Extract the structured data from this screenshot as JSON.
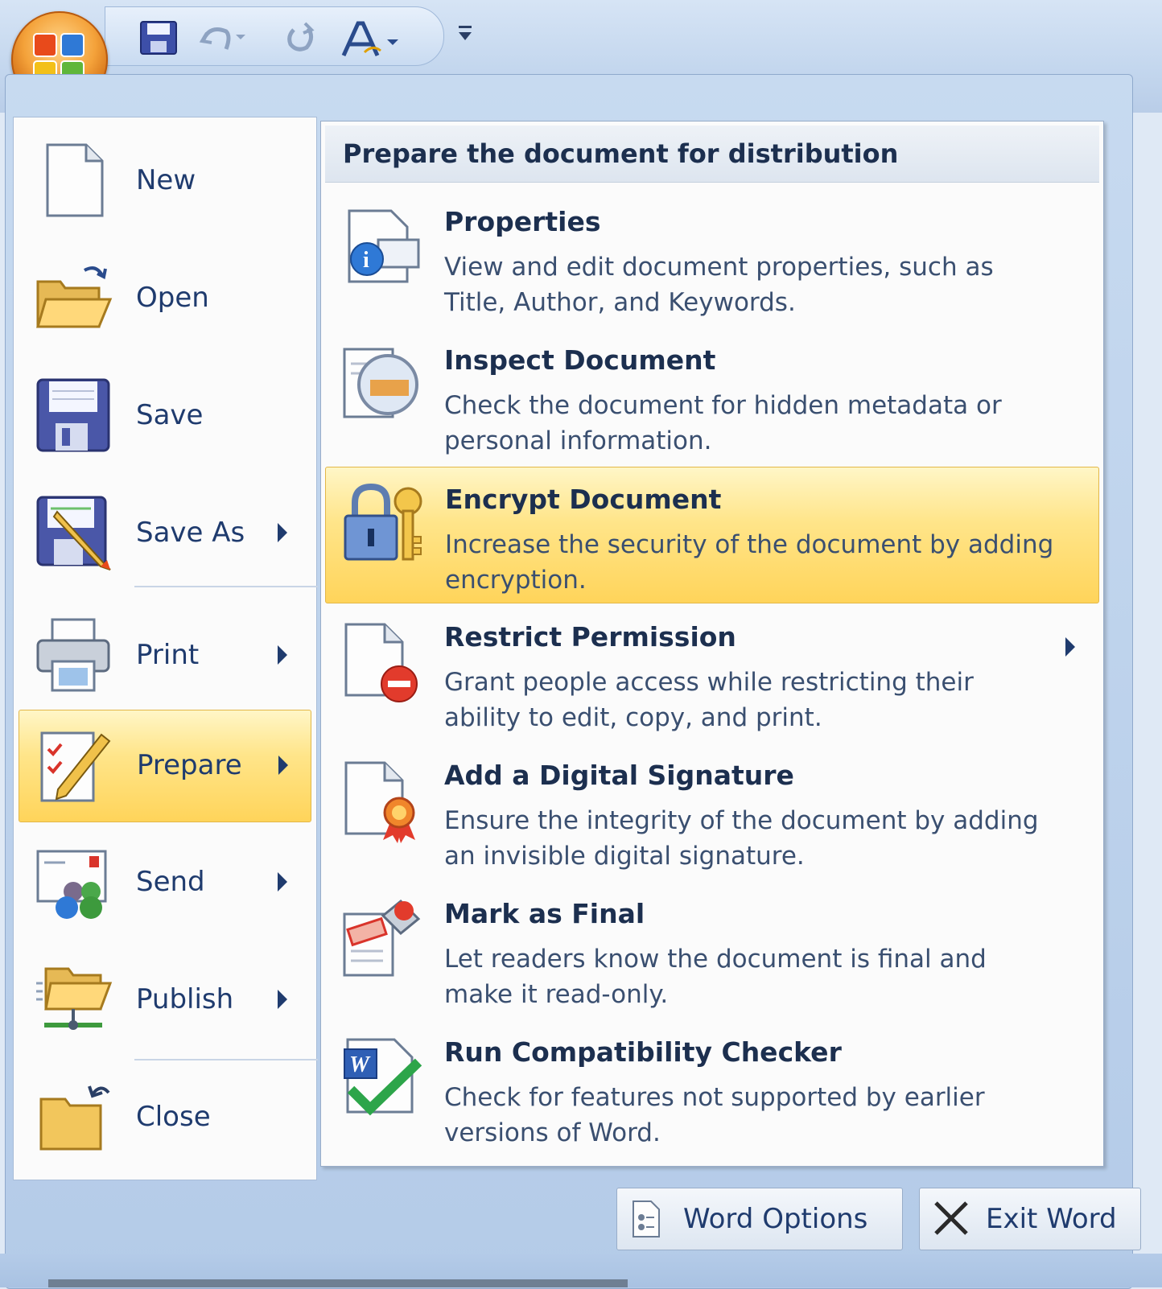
{
  "quick_access_toolbar": {
    "buttons": [
      {
        "icon": "save-icon"
      },
      {
        "icon": "undo-icon"
      },
      {
        "icon": "redo-icon"
      },
      {
        "icon": "font-style-icon"
      },
      {
        "icon": "customize-dropdown-icon"
      }
    ],
    "office_button_icon": "office-logo-icon"
  },
  "office_menu": {
    "left_items": [
      {
        "label": "New",
        "icon": "new-document-icon",
        "submenu": false
      },
      {
        "label": "Open",
        "icon": "open-folder-icon",
        "submenu": false
      },
      {
        "label": "Save",
        "icon": "save-icon",
        "submenu": false
      },
      {
        "label": "Save As",
        "icon": "save-as-icon",
        "submenu": true
      },
      {
        "label": "Print",
        "icon": "printer-icon",
        "submenu": true
      },
      {
        "label": "Prepare",
        "icon": "prepare-icon",
        "submenu": true,
        "selected": true
      },
      {
        "label": "Send",
        "icon": "send-icon",
        "submenu": true
      },
      {
        "label": "Publish",
        "icon": "publish-icon",
        "submenu": true
      },
      {
        "label": "Close",
        "icon": "close-folder-icon",
        "submenu": false
      }
    ],
    "submenu": {
      "header": "Prepare the document for distribution",
      "items": [
        {
          "title": "Properties",
          "description": "View and edit document properties, such as Title, Author, and Keywords.",
          "icon": "properties-icon"
        },
        {
          "title": "Inspect Document",
          "description": "Check the document for hidden metadata or personal information.",
          "icon": "inspect-document-icon"
        },
        {
          "title": "Encrypt Document",
          "description": "Increase the security of the document by adding encryption.",
          "icon": "lock-key-icon",
          "selected": true
        },
        {
          "title": "Restrict Permission",
          "description": "Grant people access while restricting their ability to edit, copy, and print.",
          "icon": "restrict-permission-icon",
          "submenu": true
        },
        {
          "title": "Add a Digital Signature",
          "description": "Ensure the integrity of the document by adding an invisible digital signature.",
          "icon": "digital-signature-icon"
        },
        {
          "title": "Mark as Final",
          "description": "Let readers know the document is final and make it read-only.",
          "icon": "mark-final-icon"
        },
        {
          "title": "Run Compatibility Checker",
          "description": "Check for features not supported by earlier versions of Word.",
          "icon": "compatibility-checker-icon"
        }
      ]
    },
    "bottom_buttons": {
      "word_options": "Word Options",
      "exit_word": "Exit Word"
    }
  },
  "colors": {
    "selection_highlight": "#ffd45a",
    "text_dark_blue": "#1f3b6e",
    "frame_blue": "#c7daf0"
  }
}
